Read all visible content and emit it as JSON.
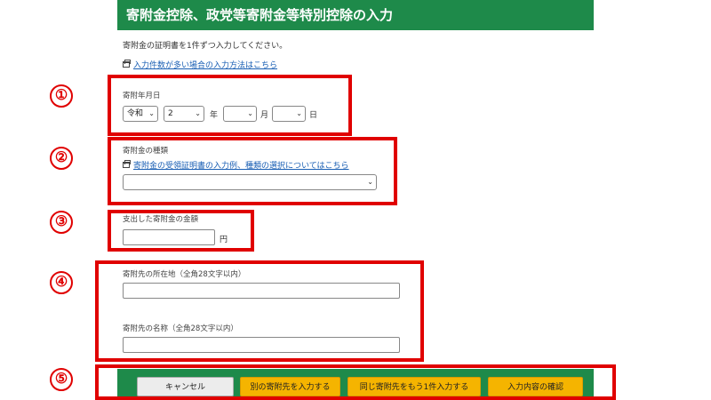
{
  "header": {
    "title": "寄附金控除、政党等寄附金等特別控除の入力"
  },
  "intro": {
    "text": "寄附金の証明書を1件ずつ入力してください。",
    "link": "入力件数が多い場合の入力方法はこちら"
  },
  "annotations": [
    "①",
    "②",
    "③",
    "④",
    "⑤"
  ],
  "date_section": {
    "label": "寄附年月日",
    "era": "令和",
    "year": "2",
    "month": "",
    "day": "",
    "year_unit": "年",
    "month_unit": "月",
    "day_unit": "日"
  },
  "type_section": {
    "label": "寄附金の種類",
    "link": "寄附金の受領証明書の入力例、種類の選択についてはこちら",
    "selected": ""
  },
  "amount_section": {
    "label": "支出した寄附金の金額",
    "value": "",
    "unit": "円"
  },
  "recipient_section": {
    "address_label": "寄附先の所在地（全角28文字以内）",
    "address_value": "",
    "name_label": "寄附先の名称（全角28文字以内）",
    "name_value": ""
  },
  "buttons": {
    "cancel": "キャンセル",
    "other": "別の寄附先を入力する",
    "same": "同じ寄附先をもう1件入力する",
    "confirm": "入力内容の確認"
  },
  "colors": {
    "header_green": "#1e8a4a",
    "annotation_red": "#e00000",
    "button_orange": "#f5b400"
  }
}
